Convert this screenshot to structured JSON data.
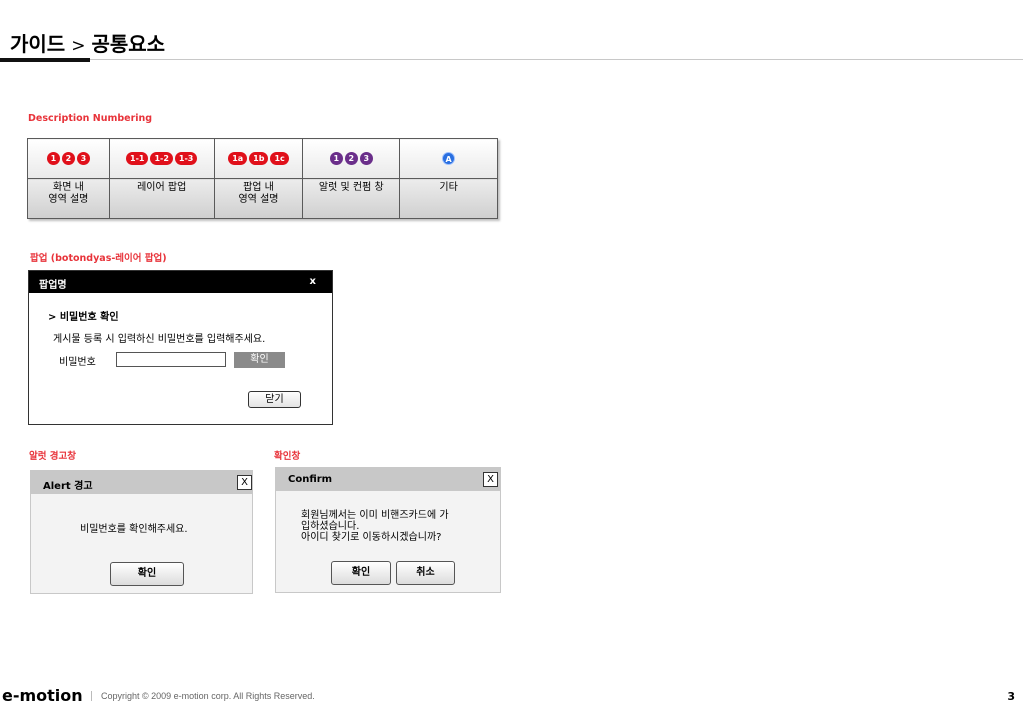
{
  "header": {
    "breadcrumb_root": "가이드",
    "breadcrumb_sep": ">",
    "breadcrumb_current": "공통요소"
  },
  "numbering": {
    "label": "Description Numbering",
    "columns": [
      {
        "badges": [
          "1",
          "2",
          "3"
        ],
        "color": "#e0101a",
        "desc_line1": "화면 내",
        "desc_line2": "영역 설명"
      },
      {
        "badges": [
          "1-1",
          "1-2",
          "1-3"
        ],
        "color": "#e0101a",
        "desc_line1": "레이어 팝업",
        "desc_line2": ""
      },
      {
        "badges": [
          "1a",
          "1b",
          "1c"
        ],
        "color": "#e0101a",
        "desc_line1": "팝업 내",
        "desc_line2": "영역 설명"
      },
      {
        "badges": [
          "1",
          "2",
          "3"
        ],
        "color": "#6a2e8a",
        "desc_line1": "알럿 및 컨펌 창",
        "desc_line2": ""
      },
      {
        "badges": [
          "A"
        ],
        "color": "#2a6fe0",
        "desc_line1": "기타",
        "desc_line2": ""
      }
    ]
  },
  "layer_popup": {
    "label": "팝업 (botondyas-레이어 팝업)",
    "title": "팝업명",
    "close": "x",
    "subtitle": "> 비밀번호 확인",
    "message": "게시물 등록 시 입력하신 비밀번호를 입력해주세요.",
    "password_label": "비밀번호",
    "password_value": "",
    "ok_button": "확인",
    "close_button": "닫기"
  },
  "alert": {
    "label": "알럿 경고창",
    "title": "Alert 경고",
    "close": "X",
    "message": "비밀번호를 확인해주세요.",
    "ok_button": "확인"
  },
  "confirm": {
    "label": "확인창",
    "title": "Confirm",
    "close": "X",
    "message_line1": "회원님께서는 이미 비핸즈카드에 가",
    "message_line2": "입하셨습니다.",
    "message_line3": "아이디 찾기로 이동하시겠습니까?",
    "ok_button": "확인",
    "cancel_button": "취소"
  },
  "footer": {
    "logo": "e-motion",
    "copyright": "Copyright © 2009 e-motion corp. All Rights Reserved.",
    "page_number": "3"
  }
}
